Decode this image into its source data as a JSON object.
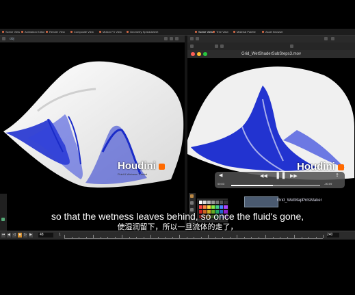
{
  "tabs": [
    {
      "label": "Scene View"
    },
    {
      "label": "Animation Editor"
    },
    {
      "label": "Render View"
    },
    {
      "label": "Composite View"
    },
    {
      "label": "Motion FX View"
    },
    {
      "label": "Geometry Spreadsheet"
    },
    {
      "label": "Scene View"
    },
    {
      "label": "Tree View"
    },
    {
      "label": "Material Palette"
    },
    {
      "label": "Asset Browser"
    }
  ],
  "toolbar": {
    "path": "obj"
  },
  "player": {
    "title": "Grid_WetShaderSubSteps3.mov",
    "time_start": "00:03",
    "time_end": "-00:09",
    "progress": 0.47
  },
  "watermark": {
    "brand": "Houdini",
    "sub": "Fluid & Wetness Tutorial"
  },
  "node": {
    "label": "Grid_WetMapPntsMaker"
  },
  "timeline": {
    "frame": "48",
    "start": "1",
    "end": "240"
  },
  "subtitles": {
    "en": "so that the wetness leaves behind, so once the fluid's gone,",
    "zh": "使湿润留下，所以一旦流体的走了，"
  },
  "colors": {
    "wet": "#2233d0",
    "terrain": "#eeeeee",
    "ui_bg": "#2a2a2a"
  }
}
